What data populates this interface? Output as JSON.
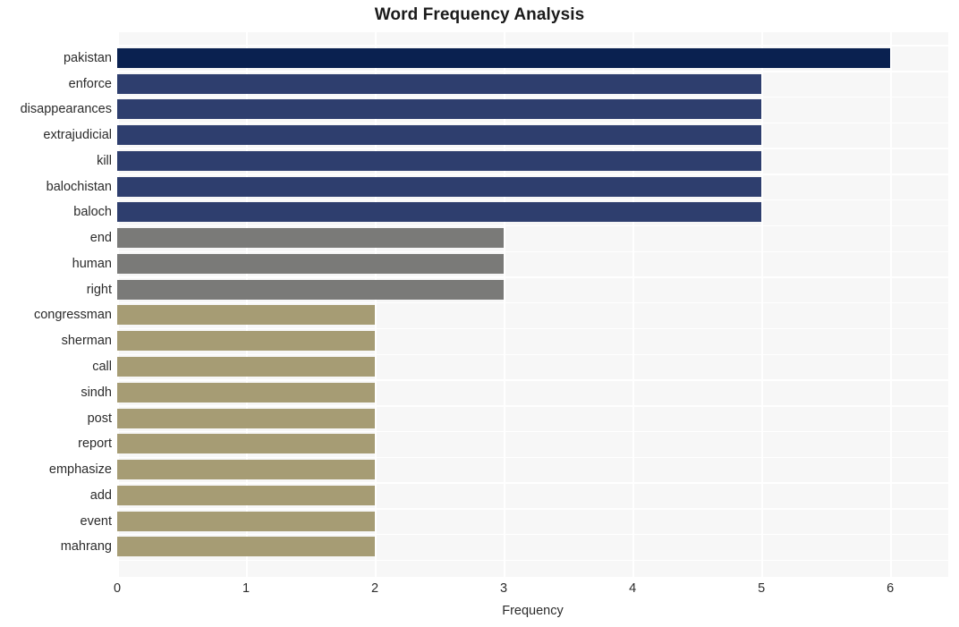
{
  "chart_data": {
    "type": "bar",
    "orientation": "horizontal",
    "title": "Word Frequency Analysis",
    "xlabel": "Frequency",
    "ylabel": "",
    "xlim": [
      0,
      6.45
    ],
    "xticks": [
      0,
      1,
      2,
      3,
      4,
      5,
      6
    ],
    "xtick_labels": [
      "0",
      "1",
      "2",
      "3",
      "4",
      "5",
      "6"
    ],
    "grid": true,
    "legend": null,
    "categories": [
      "pakistan",
      "enforce",
      "disappearances",
      "extrajudicial",
      "kill",
      "balochistan",
      "baloch",
      "end",
      "human",
      "right",
      "congressman",
      "sherman",
      "call",
      "sindh",
      "post",
      "report",
      "emphasize",
      "add",
      "event",
      "mahrang"
    ],
    "values": [
      6,
      5,
      5,
      5,
      5,
      5,
      5,
      3,
      3,
      3,
      2,
      2,
      2,
      2,
      2,
      2,
      2,
      2,
      2,
      2
    ],
    "bar_colors": [
      "#0a2150",
      "#2e3e6e",
      "#2e3e6e",
      "#2e3e6e",
      "#2e3e6e",
      "#2e3e6e",
      "#2e3e6e",
      "#7a7a78",
      "#7a7a78",
      "#7a7a78",
      "#a69c74",
      "#a69c74",
      "#a69c74",
      "#a69c74",
      "#a69c74",
      "#a69c74",
      "#a69c74",
      "#a69c74",
      "#a69c74",
      "#a69c74"
    ],
    "plot_background": "#f7f7f7",
    "grid_color": "#ffffff",
    "figure_background": "#ffffff"
  }
}
